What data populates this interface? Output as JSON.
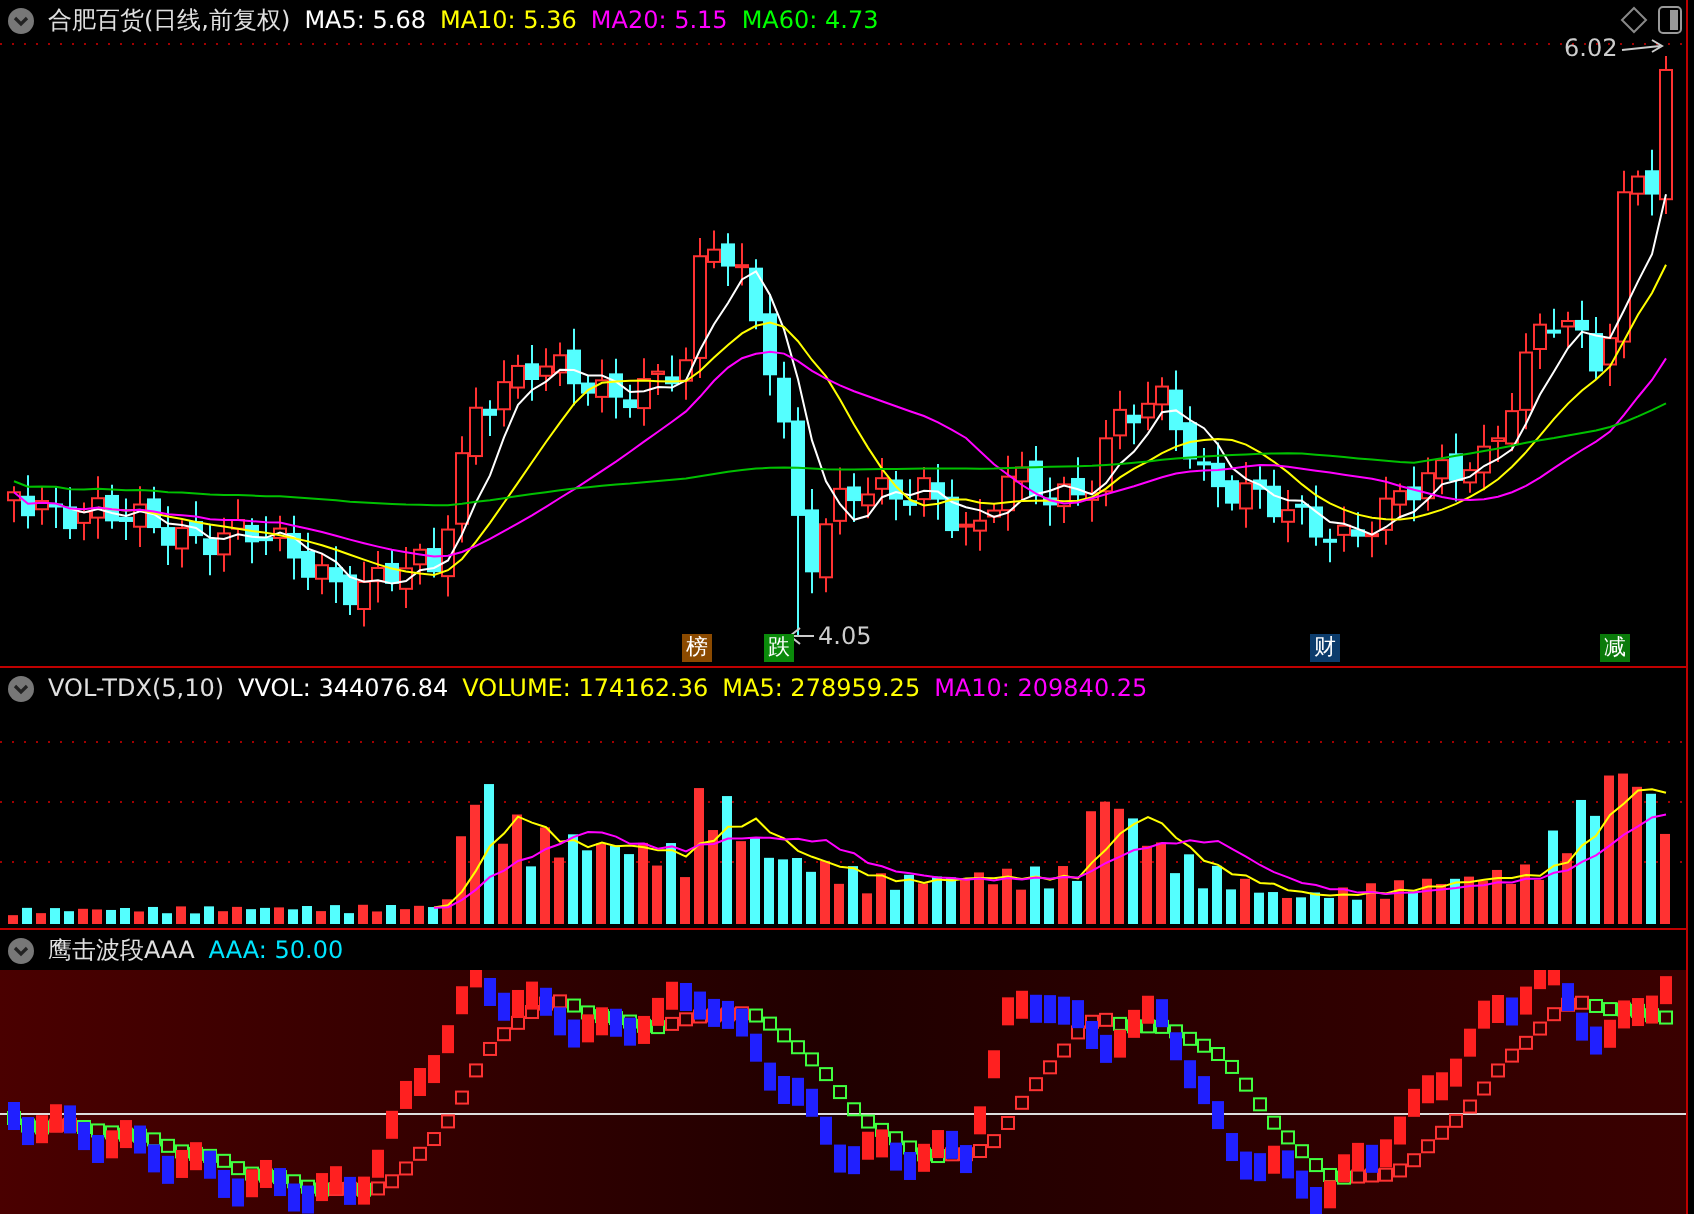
{
  "price_panel": {
    "title": "合肥百货(日线,前复权)",
    "indicators": [
      {
        "label": "MA5: 5.68",
        "color": "#ffffff"
      },
      {
        "label": "MA10: 5.36",
        "color": "#ffff00"
      },
      {
        "label": "MA20: 5.15",
        "color": "#ff00ff"
      },
      {
        "label": "MA60: 4.73",
        "color": "#00ff00"
      }
    ],
    "high_label": "6.02",
    "low_label": "4.05",
    "badges": [
      {
        "text": "榜",
        "color": "#8b4a00"
      },
      {
        "text": "跌",
        "color": "#0a8a0a"
      },
      {
        "text": "财",
        "color": "#0c3c6c"
      },
      {
        "text": "减",
        "color": "#0a7a0a"
      }
    ]
  },
  "volume_panel": {
    "title": "VOL-TDX(5,10)",
    "indicators": [
      {
        "label": "VVOL: 344076.84",
        "color": "#ffffff"
      },
      {
        "label": "VOLUME: 174162.36",
        "color": "#ffff00"
      },
      {
        "label": "MA5: 278959.25",
        "color": "#ffff00"
      },
      {
        "label": "MA10: 209840.25",
        "color": "#ff00ff"
      }
    ]
  },
  "oscillator_panel": {
    "title": "鹰击波段AAA",
    "indicators": [
      {
        "label": "AAA: 50.00",
        "color": "#00e5ff"
      }
    ]
  }
}
